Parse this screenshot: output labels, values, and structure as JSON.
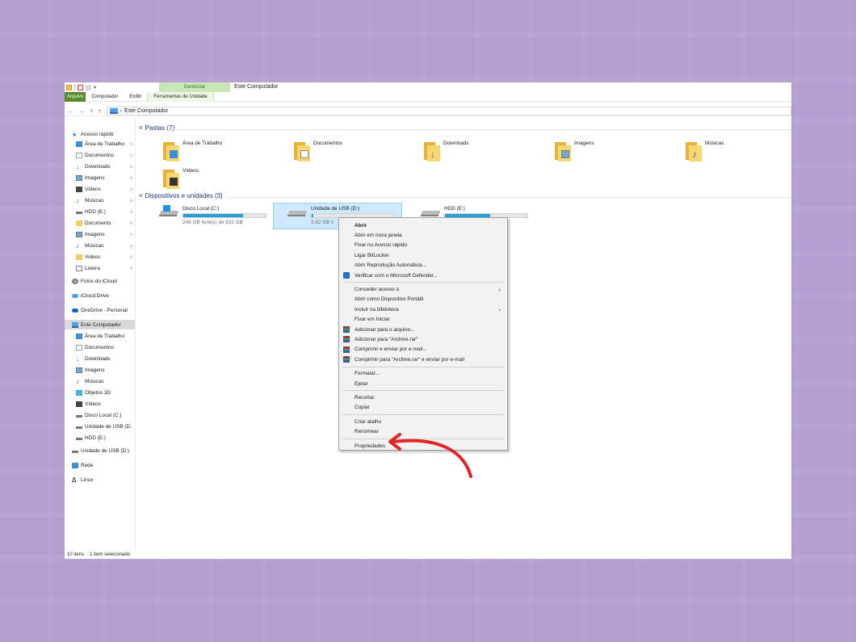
{
  "window": {
    "title": "Este Computador",
    "context_group": "Gerenciar",
    "tabs": [
      "Arquivo",
      "Computador",
      "Exibir",
      "Ferramentas de Unidade"
    ]
  },
  "address": {
    "path": "Este Computador",
    "separator": "›"
  },
  "sidebar": {
    "items": [
      {
        "label": "Acesso rápido",
        "icon": "star-icon"
      },
      {
        "label": "Área de Trabalho",
        "icon": "desktop-icon",
        "pinned": true
      },
      {
        "label": "Documentos",
        "icon": "document-icon",
        "pinned": true
      },
      {
        "label": "Downloads",
        "icon": "download-icon",
        "pinned": true
      },
      {
        "label": "Imagens",
        "icon": "image-icon",
        "pinned": true
      },
      {
        "label": "Vídeos",
        "icon": "video-icon",
        "pinned": true
      },
      {
        "label": "Músicas",
        "icon": "music-icon",
        "pinned": true
      },
      {
        "label": "HDD (E:)",
        "icon": "drive-icon",
        "pinned": true
      },
      {
        "label": "Documents",
        "icon": "folder-icon",
        "pinned": true
      },
      {
        "label": "Imagens",
        "icon": "image-icon",
        "pinned": true
      },
      {
        "label": "Músicas",
        "icon": "music-icon",
        "pinned": true
      },
      {
        "label": "Videos",
        "icon": "folder-icon",
        "pinned": true
      },
      {
        "label": "Lixeira",
        "icon": "recycle-bin-icon",
        "pinned": true
      },
      {
        "label": "Fotos do iCloud",
        "icon": "photos-icon"
      },
      {
        "label": "iCloud Drive",
        "icon": "icloud-icon"
      },
      {
        "label": "OneDrive - Personal",
        "icon": "onedrive-icon"
      },
      {
        "label": "Este Computador",
        "icon": "computer-icon",
        "selected": true
      },
      {
        "label": "Área de Trabalho",
        "icon": "desktop-icon"
      },
      {
        "label": "Documentos",
        "icon": "document-icon"
      },
      {
        "label": "Downloads",
        "icon": "download-icon"
      },
      {
        "label": "Imagens",
        "icon": "image-icon"
      },
      {
        "label": "Músicas",
        "icon": "music-icon"
      },
      {
        "label": "Objetos 3D",
        "icon": "3d-objects-icon"
      },
      {
        "label": "Vídeos",
        "icon": "video-icon"
      },
      {
        "label": "Disco Local (C:)",
        "icon": "drive-icon"
      },
      {
        "label": "Unidade de USB (D:",
        "icon": "drive-icon"
      },
      {
        "label": "HDD (E:)",
        "icon": "drive-icon"
      },
      {
        "label": "Unidade de USB (D:)",
        "icon": "drive-icon"
      },
      {
        "label": "Rede",
        "icon": "network-icon"
      },
      {
        "label": "Linux",
        "icon": "linux-icon"
      }
    ]
  },
  "status": {
    "count": "10 itens",
    "selection": "1 item selecionado"
  },
  "folders_section": {
    "title": "Pastas (7)",
    "items": [
      {
        "label": "Área de Trabalho",
        "badge": "desktop"
      },
      {
        "label": "Documentos",
        "badge": "document"
      },
      {
        "label": "Downloads",
        "badge": "download"
      },
      {
        "label": "Imagens",
        "badge": "image"
      },
      {
        "label": "Músicas",
        "badge": "music"
      },
      {
        "label": "Vídeos",
        "badge": "video"
      }
    ]
  },
  "drives_section": {
    "title": "Dispositivos e unidades (3)",
    "items": [
      {
        "label": "Disco Local (C:)",
        "free": "248 GB livre(s) de 931 GB",
        "used_fraction": 0.73
      },
      {
        "label": "Unidade de USB (D:)",
        "free": "3,62 GB li",
        "used_fraction": 0.02,
        "selected": true
      },
      {
        "label": "HDD (E:)",
        "free": "",
        "used_fraction": 0.55
      }
    ]
  },
  "context_menu": {
    "groups": [
      [
        {
          "label": "Abrir",
          "bold": true
        },
        {
          "label": "Abrir em nova janela"
        },
        {
          "label": "Fixar no Acesso rápido"
        },
        {
          "label": "Ligar BitLocker"
        },
        {
          "label": "Abrir Reprodução Automática..."
        },
        {
          "label": "Verificar com o Microsoft Defender...",
          "icon": "defender-icon"
        }
      ],
      [
        {
          "label": "Conceder acesso a",
          "submenu": true
        },
        {
          "label": "Abrir como Dispositivo Portátil"
        },
        {
          "label": "Incluir na biblioteca",
          "submenu": true
        },
        {
          "label": "Fixar em Iniciar"
        },
        {
          "label": "Adicionar para o arquivo...",
          "icon": "winrar-icon"
        },
        {
          "label": "Adicionar para \"Archive.rar\"",
          "icon": "winrar-icon"
        },
        {
          "label": "Comprimir e enviar por e-mail...",
          "icon": "winrar-icon"
        },
        {
          "label": "Comprimir para \"Archive.rar\" e enviar por e-mail",
          "icon": "winrar-icon"
        }
      ],
      [
        {
          "label": "Formatar..."
        },
        {
          "label": "Ejetar"
        }
      ],
      [
        {
          "label": "Recortar"
        },
        {
          "label": "Copiar"
        }
      ],
      [
        {
          "label": "Criar atalho"
        },
        {
          "label": "Renomear"
        }
      ],
      [
        {
          "label": "Propriedades"
        }
      ]
    ]
  },
  "colors": {
    "background": "#b39dd1",
    "accent": "#26a0da",
    "annotation_arrow": "#e02626",
    "file_tab": "#5a8b2b"
  }
}
